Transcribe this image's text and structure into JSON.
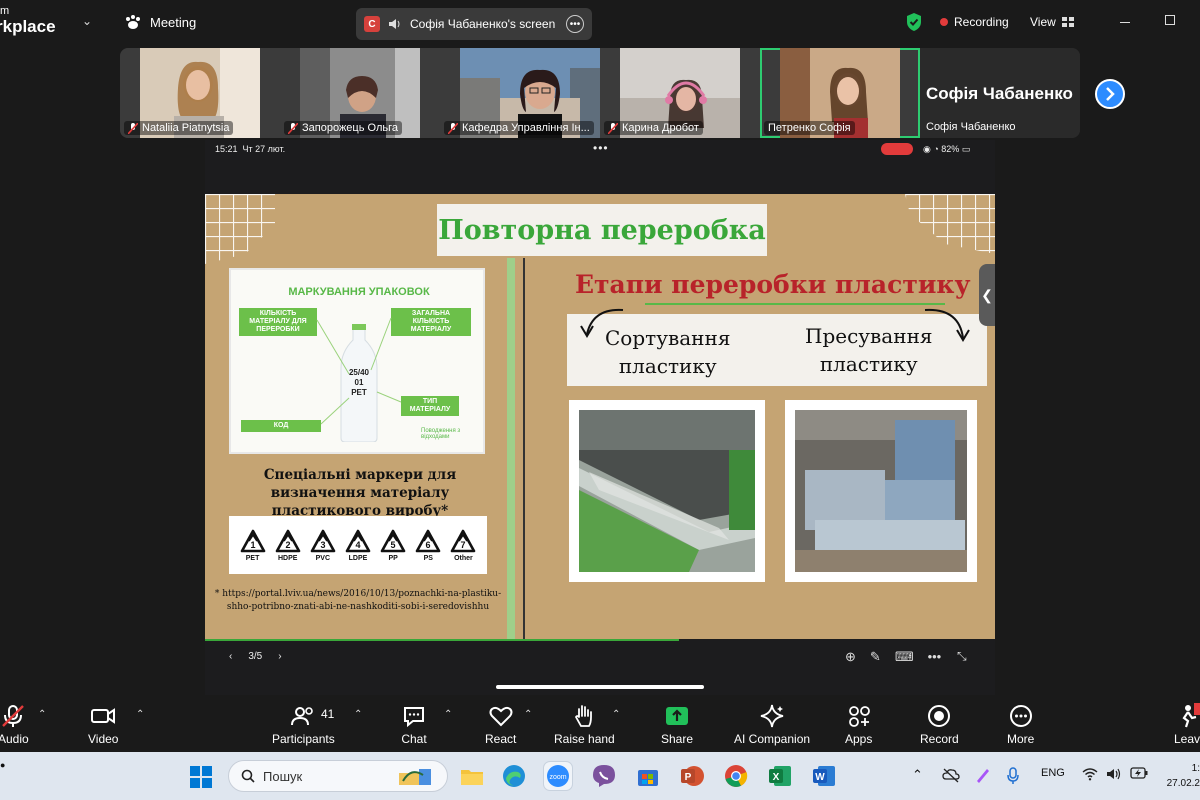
{
  "topbar": {
    "brand_line1": "m",
    "brand_line2": "rkplace",
    "meeting_label": "Meeting",
    "screen_badge": "С",
    "screen_label": "Софія Чабаненко's screen",
    "recording_label": "Recording",
    "view_label": "View"
  },
  "participants": [
    {
      "name": "Nataliia Piatnytsia",
      "muted": true
    },
    {
      "name": "Запорожець Ольга",
      "muted": true
    },
    {
      "name": "Кафедра Управління Ін...",
      "muted": true
    },
    {
      "name": "Карина Дробот",
      "muted": true
    },
    {
      "name": "Петренко Софія",
      "muted": false
    }
  ],
  "speaker": {
    "big_name": "Софія Чабаненко",
    "small_name": "Софія Чабаненко"
  },
  "device_status": {
    "time": "15:21",
    "date": "Чт 27 лют.",
    "battery": "82%"
  },
  "slide": {
    "title": "Повторна переробка",
    "infographic": {
      "title": "МАРКУВАННЯ УПАКОВОК",
      "tag_quantity": "КІЛЬКІСТЬ МАТЕРІАЛУ ДЛЯ ПЕРЕРОБКИ",
      "tag_total": "ЗАГАЛЬНА КІЛЬКІСТЬ МАТЕРІАЛУ",
      "tag_type": "ТИП МАТЕРІАЛУ",
      "tag_code": "КОД",
      "bottle_ratio": "25/40",
      "bottle_code": "01",
      "bottle_material": "PET",
      "logo": "Поводження з відходами"
    },
    "markers_caption": "Спеціальні маркери для визначення матеріалу пластикового виробу*",
    "codes": [
      {
        "num": "1",
        "label": "PET"
      },
      {
        "num": "2",
        "label": "HDPE"
      },
      {
        "num": "3",
        "label": "PVC"
      },
      {
        "num": "4",
        "label": "LDPE"
      },
      {
        "num": "5",
        "label": "PP"
      },
      {
        "num": "6",
        "label": "PS"
      },
      {
        "num": "7",
        "label": "Other"
      }
    ],
    "footnote": "* https://portal.lviv.ua/news/2016/10/13/poznachki-na-plastiku-shho-potribno-znati-abi-ne-nashkoditi-sobi-i-seredovishhu",
    "stages_title": "Етапи переробки пластику",
    "stage_a_line1": "Сортування",
    "stage_a_line2": "пластику",
    "stage_b_line1": "Пресування",
    "stage_b_line2": "пластику"
  },
  "pager": {
    "current": "3/5"
  },
  "toolbar": {
    "audio": "Audio",
    "video": "Video",
    "participants": "Participants",
    "participants_count": "41",
    "chat": "Chat",
    "react": "React",
    "raise_hand": "Raise hand",
    "share": "Share",
    "ai_companion": "AI Companion",
    "apps": "Apps",
    "record": "Record",
    "more": "More",
    "leave": "Leav"
  },
  "taskbar": {
    "search_placeholder": "Пошук",
    "lang": "ENG",
    "clock_time": "1:",
    "clock_date": "27.02.2"
  },
  "colors": {
    "slide_green": "#3aa73a",
    "slide_red": "#b8232a",
    "kraft_paper": "#c9a978",
    "share_green": "#21c05a",
    "accent_blue": "#2d8cff",
    "recording_red": "#e23b3b"
  }
}
